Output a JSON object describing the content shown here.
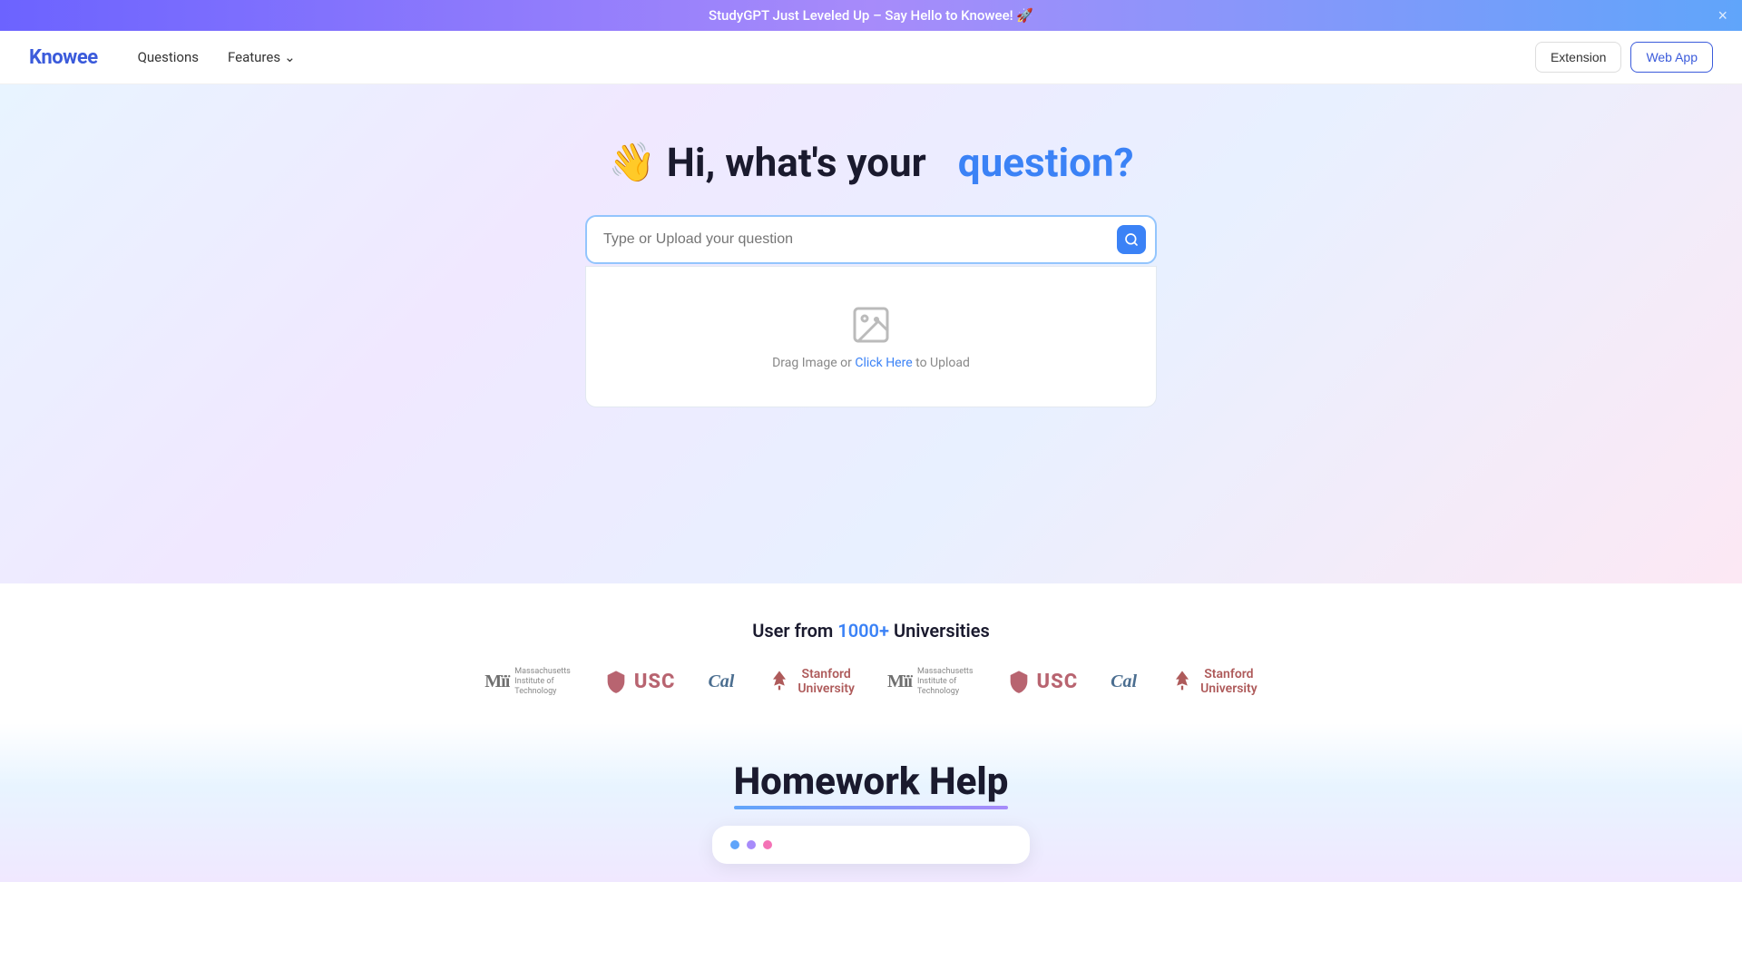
{
  "banner": {
    "text": "StudyGPT Just Leveled Up – Say Hello to Knowee! 🚀",
    "close_label": "×"
  },
  "navbar": {
    "logo": "Knowee",
    "links": [
      {
        "label": "Questions",
        "has_dropdown": false
      },
      {
        "label": "Features",
        "has_dropdown": true
      }
    ],
    "actions": {
      "extension": "Extension",
      "webapp": "Web App"
    }
  },
  "hero": {
    "emoji": "👋",
    "title_pre": "Hi, what's your",
    "title_accent": "question?",
    "search_placeholder": "Type or Upload your question",
    "upload_text_pre": "Drag Image or",
    "upload_link": "Click Here",
    "upload_text_post": "to Upload",
    "search_icon": "🔍"
  },
  "universities": {
    "title_pre": "User from",
    "count": "1000+",
    "title_post": "Universities",
    "logos": [
      {
        "name": "MIT",
        "full": "Massachusetts Institute of Technology",
        "type": "mit"
      },
      {
        "name": "USC",
        "full": "USC",
        "type": "usc"
      },
      {
        "name": "Cal",
        "full": "Cal",
        "type": "cal"
      },
      {
        "name": "Stanford University",
        "full": "Stanford University",
        "type": "stanford"
      },
      {
        "name": "MIT",
        "full": "Massachusetts Institute of Technology",
        "type": "mit"
      },
      {
        "name": "USC",
        "full": "USC",
        "type": "usc"
      },
      {
        "name": "Cal",
        "full": "Cal",
        "type": "cal"
      },
      {
        "name": "Stanford University",
        "full": "Stanford University",
        "type": "stanford"
      }
    ]
  },
  "homework": {
    "title": "Homework Help",
    "dots": [
      "#60a5fa",
      "#a78bfa",
      "#f472b6"
    ]
  }
}
